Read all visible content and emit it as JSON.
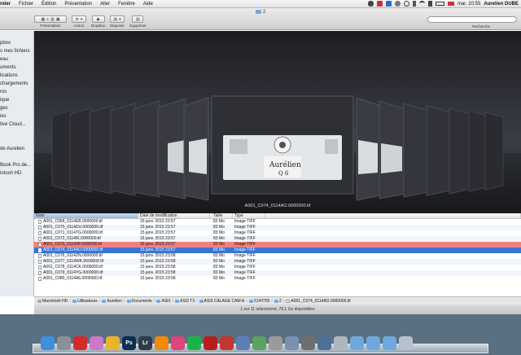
{
  "menubar": {
    "app": "nder",
    "items": [
      "Fichier",
      "Édition",
      "Présentation",
      "Aller",
      "Fenêtre",
      "Aide"
    ],
    "clock": "mar. 20:55",
    "user": "Aurelien DUBE"
  },
  "window": {
    "title": "2",
    "toolbar": {
      "presentation_label": "Présentation",
      "action_label": "Action",
      "dropbox_label": "Dropbox",
      "disposer_label": "Disposer",
      "supprimer_label": "Supprimer"
    },
    "search_label": "Recherche"
  },
  "sidebar": {
    "items": [
      "pbox",
      "s mes fichiers",
      "eau",
      "uments",
      "lications",
      "chargements",
      "ros",
      "ique",
      "ges",
      "ies",
      "tive Cloud...",
      "de Aurelien",
      "Book Pro de...",
      "intosh HD"
    ]
  },
  "coverflow": {
    "caption": "A001_C074_0114AO.0000000.tif",
    "card_writing": "Aurélien\nQ 6"
  },
  "filelist": {
    "headers": {
      "name": "Nom",
      "date": "Date de modification",
      "size": "Taille",
      "type": "Type"
    },
    "rows": [
      {
        "name": "A001_C069_0114EB.0000000.tif",
        "date": "15 janv. 2015 23:57",
        "size": "83 Mo",
        "type": "Image TIFF",
        "state": "normal"
      },
      {
        "name": "A001_C070_0114DU.0000000.tif",
        "date": "15 janv. 2015 23:57",
        "size": "83 Mo",
        "type": "Image TIFF",
        "state": "normal"
      },
      {
        "name": "A001_C071_0114TG.0000000.tif",
        "date": "15 janv. 2015 23:57",
        "size": "83 Mo",
        "type": "Image TIFF",
        "state": "normal"
      },
      {
        "name": "A001_C072_0114IK.0000000.tif",
        "date": "15 janv. 2015 23:57",
        "size": "83 Mo",
        "type": "Image TIFF",
        "state": "normal"
      },
      {
        "name": "A001_C073_0114XF.0000000.tif",
        "date": "15 janv. 2015 23:57",
        "size": "83 Mo",
        "type": "Image TIFF",
        "state": "label-red"
      },
      {
        "name": "A001_C074_0114AO.0000000.tif",
        "date": "15 janv. 2015 23:57",
        "size": "83 Mo",
        "type": "Image TIFF",
        "state": "selected"
      },
      {
        "name": "A001_C076_0114ZN.0000000.tif",
        "date": "15 janv. 2015 23:58",
        "size": "83 Mo",
        "type": "Image TIFF",
        "state": "normal"
      },
      {
        "name": "A001_C077_0114WK.0000000.tif",
        "date": "15 janv. 2015 23:58",
        "size": "83 Mo",
        "type": "Image TIFF",
        "state": "normal"
      },
      {
        "name": "A001_C078_0114CK.0000000.tif",
        "date": "15 janv. 2015 23:58",
        "size": "83 Mo",
        "type": "Image TIFF",
        "state": "normal"
      },
      {
        "name": "A001_C079_0114YG.0000000.tif",
        "date": "15 janv. 2015 23:58",
        "size": "83 Mo",
        "type": "Image TIFF",
        "state": "normal"
      },
      {
        "name": "A001_C080_0114A6.0000000.tif",
        "date": "15 janv. 2015 23:58",
        "size": "83 Mo",
        "type": "Image TIFF",
        "state": "normal"
      }
    ]
  },
  "pathbar": {
    "crumbs": [
      "Macintosh HD",
      "Utilisateurs",
      "Aurelien",
      "Documents",
      "ASI3",
      "ASI3 T3",
      "ASI3 CALAGE CAM A",
      "21#0755",
      "2",
      "A001_C074_0114AO.0000000.tif"
    ]
  },
  "status": "1 sur 11 sélectionné, 78,1 Go disponibles",
  "dock": {
    "apps": [
      {
        "name": "finder",
        "color": "#3d8fe0",
        "glyph": ""
      },
      {
        "name": "compass",
        "color": "#8a8f98",
        "glyph": ""
      },
      {
        "name": "red-app",
        "color": "#d42a2a",
        "glyph": ""
      },
      {
        "name": "photos",
        "color": "#c87ac4",
        "glyph": ""
      },
      {
        "name": "chrome",
        "color": "#e9b429",
        "glyph": ""
      },
      {
        "name": "photoshop",
        "color": "#0b2f4f",
        "glyph": "Ps"
      },
      {
        "name": "lightroom",
        "color": "#2b3c4a",
        "glyph": "Lr"
      },
      {
        "name": "vlc",
        "color": "#f08a0b",
        "glyph": ""
      },
      {
        "name": "itunes",
        "color": "#e0447a",
        "glyph": ""
      },
      {
        "name": "spotify",
        "color": "#1ab34a",
        "glyph": ""
      },
      {
        "name": "red-circle",
        "color": "#b81d1d",
        "glyph": ""
      },
      {
        "name": "media",
        "color": "#c1372f",
        "glyph": ""
      },
      {
        "name": "app-a",
        "color": "#5a7fb5",
        "glyph": ""
      },
      {
        "name": "app-b",
        "color": "#58a45f",
        "glyph": ""
      },
      {
        "name": "app-c",
        "color": "#9a9a9a",
        "glyph": ""
      },
      {
        "name": "app-d",
        "color": "#7b8fb0",
        "glyph": ""
      },
      {
        "name": "app-e",
        "color": "#6e6e6e",
        "glyph": ""
      },
      {
        "name": "app-f",
        "color": "#4f6f99",
        "glyph": ""
      },
      {
        "name": "app-g",
        "color": "#b0b6bf",
        "glyph": ""
      },
      {
        "name": "folder-1",
        "color": "#6fa8dc",
        "glyph": ""
      },
      {
        "name": "folder-2",
        "color": "#6fa8dc",
        "glyph": ""
      },
      {
        "name": "folder-3",
        "color": "#6fa8dc",
        "glyph": ""
      },
      {
        "name": "trash",
        "color": "#b9c2cc",
        "glyph": ""
      }
    ]
  }
}
